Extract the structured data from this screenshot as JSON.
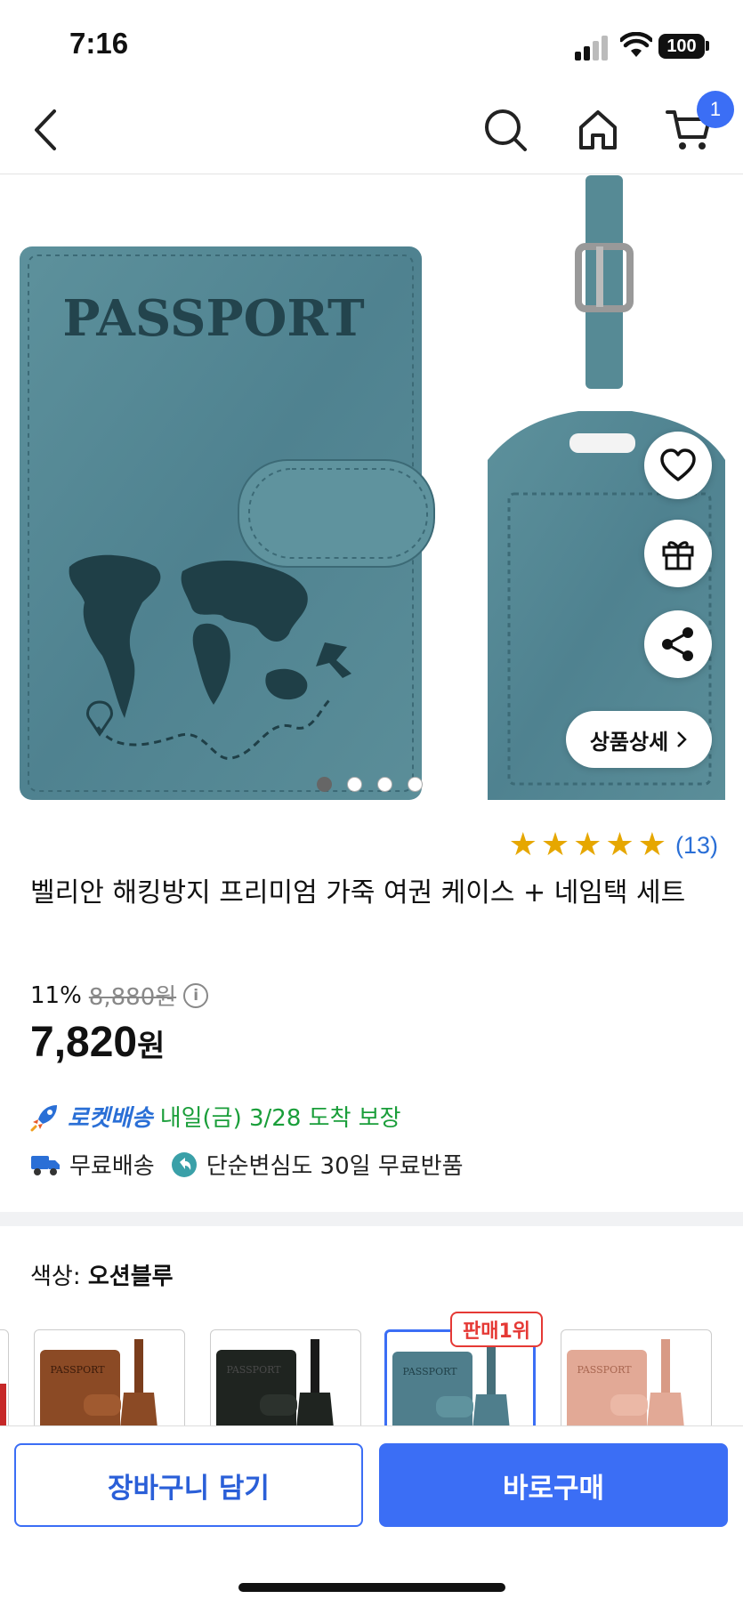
{
  "status": {
    "time": "7:16",
    "battery": "100"
  },
  "nav": {
    "cart_count": "1"
  },
  "hero": {
    "passport_text": "PASSPORT",
    "detail_label": "상품상세",
    "dots_total": 4,
    "dots_active_index": 0
  },
  "product": {
    "rating_stars": 5,
    "rating_count": "(13)",
    "title": "벨리안 해킹방지 프리미엄 가죽 여권 케이스 + 네임택 세트",
    "discount": "11%",
    "original_price": "8,880원",
    "price_value": "7,820",
    "price_unit": "원"
  },
  "delivery": {
    "rocket_label": "로켓배송",
    "arrival_text": "내일(금) 3/28 도착 보장",
    "free_shipping": "무료배송",
    "return_policy": "단순변심도 30일 무료반품"
  },
  "options": {
    "label": "색상:",
    "selected": "오션블루",
    "best_badge": "판매1위",
    "thumbs": [
      {
        "name": "brown",
        "color": "#8b4a25",
        "text": "PASSPORT"
      },
      {
        "name": "black",
        "color": "#1f2420",
        "text": "PASSPORT"
      },
      {
        "name": "ocean-blue",
        "color": "#4f7e8c",
        "text": "PASSPORT",
        "selected": true
      },
      {
        "name": "pink",
        "color": "#e2a996",
        "text": "PASSPORT"
      }
    ]
  },
  "bottom": {
    "cart_label": "장바구니 담기",
    "buy_label": "바로구매"
  },
  "colors": {
    "accent": "#3b6ef5",
    "rocket": "#2a6fd6",
    "arrival": "#1a9e3a",
    "star": "#e6a700",
    "leather": "#5a8c98"
  }
}
